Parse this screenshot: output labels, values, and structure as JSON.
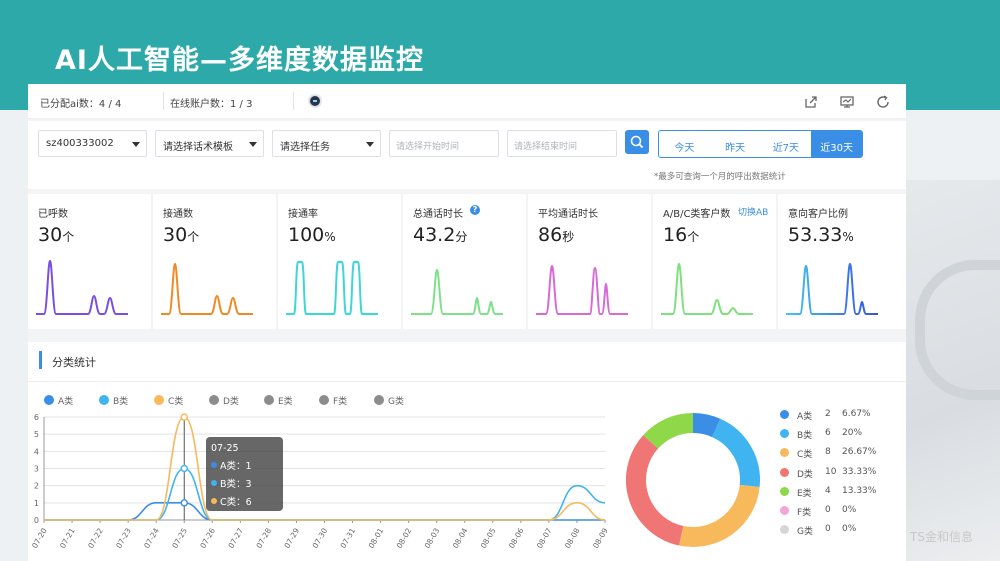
{
  "page": {
    "title": "AI人工智能—多维度数据监控",
    "watermark": "TS金和信息"
  },
  "info_bar": {
    "ai_assigned": "已分配ai数：4 / 4",
    "online_accounts": "在线账户数：1 / 3",
    "icons": [
      "share-icon",
      "screen-icon",
      "refresh-icon"
    ]
  },
  "filters": {
    "account_value": "sz400333002",
    "template_placeholder": "请选择话术模板",
    "task_placeholder": "请选择任务",
    "start_placeholder": "请选择开始时间",
    "end_placeholder": "请选择结束时间",
    "ranges": [
      "今天",
      "昨天",
      "近7天",
      "近30天"
    ],
    "active_range": "近30天",
    "note": "*最多可查询一个月的呼出数据统计"
  },
  "stats": [
    {
      "label": "已呼数",
      "value": "30",
      "unit": "个",
      "color": "#7a4fe0"
    },
    {
      "label": "接通数",
      "value": "30",
      "unit": "个",
      "color": "#f08a24"
    },
    {
      "label": "接通率",
      "value": "100",
      "unit": "%",
      "color": "#3fd6d6"
    },
    {
      "label": "总通话时长",
      "value": "43.2",
      "unit": "分",
      "color": "#7fe08a"
    },
    {
      "label": "平均通话时长",
      "value": "86",
      "unit": "秒",
      "color": "#d66ad6"
    },
    {
      "label": "A/B/C类客户数",
      "value": "16",
      "unit": "个",
      "extra": "切换AB",
      "color": "#7ee07e"
    },
    {
      "label": "意向客户比例",
      "value": "53.33",
      "unit": "%",
      "color": "#3a6fe0"
    }
  ],
  "category": {
    "title": "分类统计",
    "legend": [
      {
        "name": "A类",
        "color": "#3a8ee6"
      },
      {
        "name": "B类",
        "color": "#40b4f0"
      },
      {
        "name": "C类",
        "color": "#f7b95c"
      },
      {
        "name": "D类",
        "color": "#8c8c8c"
      },
      {
        "name": "E类",
        "color": "#8c8c8c"
      },
      {
        "name": "F类",
        "color": "#8c8c8c"
      },
      {
        "name": "G类",
        "color": "#8c8c8c"
      }
    ],
    "tooltip": {
      "date": "07-25",
      "rows": [
        "A类：1",
        "B类：3",
        "C类：6"
      ]
    },
    "pie_legend": [
      {
        "name": "A类",
        "count": "2",
        "pct": "6.67%",
        "color": "#3a8ee6"
      },
      {
        "name": "B类",
        "count": "6",
        "pct": "20%",
        "color": "#40b4f0"
      },
      {
        "name": "C类",
        "count": "8",
        "pct": "26.67%",
        "color": "#f7b95c"
      },
      {
        "name": "D类",
        "count": "10",
        "pct": "33.33%",
        "color": "#f07575"
      },
      {
        "name": "E类",
        "count": "4",
        "pct": "13.33%",
        "color": "#8ed84a"
      },
      {
        "name": "F类",
        "count": "0",
        "pct": "0%",
        "color": "#f2a6d6"
      },
      {
        "name": "G类",
        "count": "0",
        "pct": "0%",
        "color": "#d6d6d6"
      }
    ]
  },
  "chart_data": [
    {
      "type": "line",
      "x": [
        "07-20",
        "07-21",
        "07-22",
        "07-23",
        "07-24",
        "07-25",
        "07-26",
        "07-27",
        "07-28",
        "07-29",
        "07-30",
        "07-31",
        "08-01",
        "08-02",
        "08-03",
        "08-04",
        "08-05",
        "08-06",
        "08-07",
        "08-08",
        "08-09"
      ],
      "ylim": [
        0,
        6
      ],
      "yticks": [
        0,
        1,
        2,
        3,
        4,
        5,
        6
      ],
      "series": [
        {
          "name": "A类",
          "color": "#3a8ee6",
          "values": [
            0,
            0,
            0,
            0,
            1,
            1,
            0,
            0,
            0,
            0,
            0,
            0,
            0,
            0,
            0,
            0,
            0,
            0,
            0,
            0,
            0
          ]
        },
        {
          "name": "B类",
          "color": "#40b4f0",
          "values": [
            0,
            0,
            0,
            0,
            0,
            3,
            0,
            0,
            0,
            0,
            0,
            0,
            0,
            0,
            0,
            0,
            0,
            0,
            0,
            2,
            1
          ]
        },
        {
          "name": "C类",
          "color": "#f7b95c",
          "values": [
            0,
            0,
            0,
            0,
            0,
            6,
            0,
            0,
            0,
            0,
            0,
            0,
            0,
            0,
            0,
            0,
            0,
            0,
            0,
            1,
            0
          ]
        }
      ]
    },
    {
      "type": "pie",
      "categories": [
        "A类",
        "B类",
        "C类",
        "D类",
        "E类",
        "F类",
        "G类"
      ],
      "values": [
        2,
        6,
        8,
        10,
        4,
        0,
        0
      ],
      "colors": [
        "#3a8ee6",
        "#40b4f0",
        "#f7b95c",
        "#f07575",
        "#8ed84a",
        "#f2a6d6",
        "#d6d6d6"
      ]
    }
  ]
}
